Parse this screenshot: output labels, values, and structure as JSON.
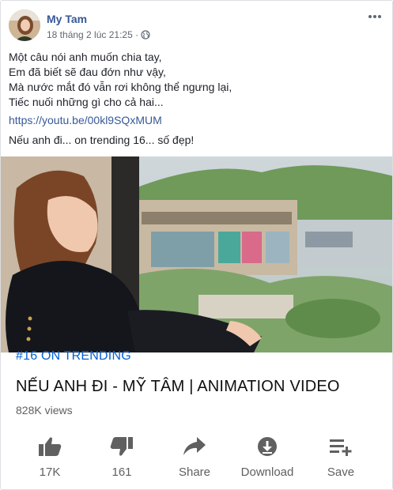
{
  "post": {
    "author": "My Tam",
    "timestamp": "18 tháng 2 lúc 21:25 ·",
    "text_lines": [
      "Một câu nói anh muốn chia tay,",
      "Em đã biết sẽ đau đớn như vậy,",
      "Mà nước mắt đó vẫn rơi không thể ngưng lại,",
      "Tiếc nuối những gì cho cả hai..."
    ],
    "link": "https://youtu.be/00kl9SQxMUM",
    "trending_text": "Nếu anh đi... on trending 16... số đẹp!"
  },
  "video": {
    "trending_badge": "#16 ON TRENDING",
    "title": "NẾU ANH ĐI - MỸ TÂM | ANIMATION VIDEO",
    "views": "828K views",
    "actions": [
      {
        "icon": "thumbs-up-icon",
        "label": "17K"
      },
      {
        "icon": "thumbs-down-icon",
        "label": "161"
      },
      {
        "icon": "share-icon",
        "label": "Share"
      },
      {
        "icon": "download-icon",
        "label": "Download"
      },
      {
        "icon": "save-playlist-icon",
        "label": "Save"
      }
    ]
  },
  "colors": {
    "author_link": "#385898",
    "trending_blue": "#065fd4",
    "action_gray": "#606060"
  }
}
